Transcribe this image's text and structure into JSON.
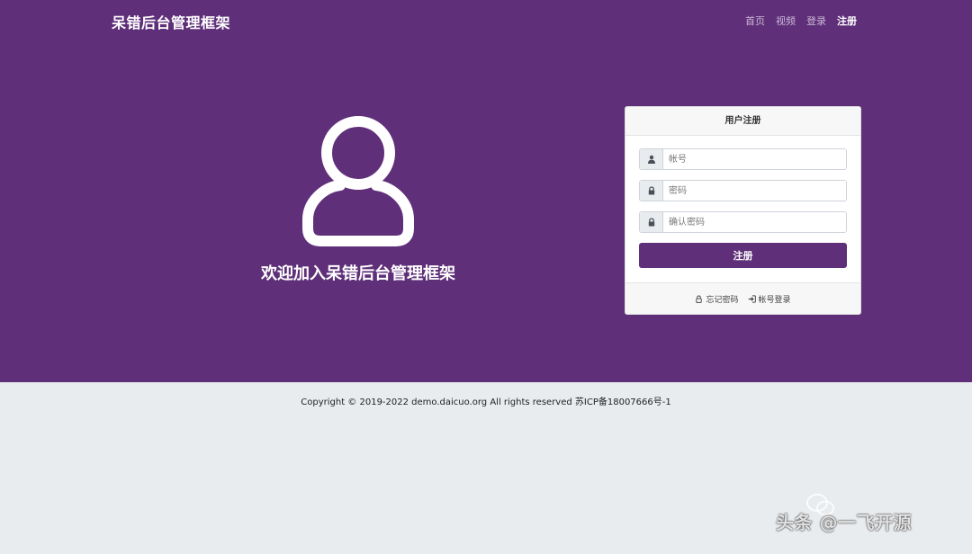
{
  "brand": {
    "name": "呆错后台管理框架"
  },
  "nav": {
    "items": [
      {
        "label": "首页"
      },
      {
        "label": "视频"
      },
      {
        "label": "登录"
      },
      {
        "label": "注册"
      }
    ],
    "active": "注册"
  },
  "hero": {
    "welcome": "欢迎加入呆错后台管理框架",
    "avatar_icon": "user-outline-icon"
  },
  "register_form": {
    "title": "用户注册",
    "account": {
      "placeholder": "帐号",
      "value": "",
      "icon": "user-icon"
    },
    "password": {
      "placeholder": "密码",
      "value": "",
      "icon": "lock-icon"
    },
    "confirm_password": {
      "placeholder": "确认密码",
      "value": "",
      "icon": "lock-icon"
    },
    "submit_label": "注册",
    "footer": {
      "forgot_password": "忘记密码",
      "account_login": "帐号登录"
    }
  },
  "footer": {
    "copyright": "Copyright © 2019-2022 demo.daicuo.org All rights reserved 苏ICP备18007666号-1"
  },
  "watermark": {
    "text": "头条 @一飞开源"
  },
  "colors": {
    "primary": "#5f3079",
    "page_background": "#e9ecef",
    "white": "#ffffff"
  }
}
